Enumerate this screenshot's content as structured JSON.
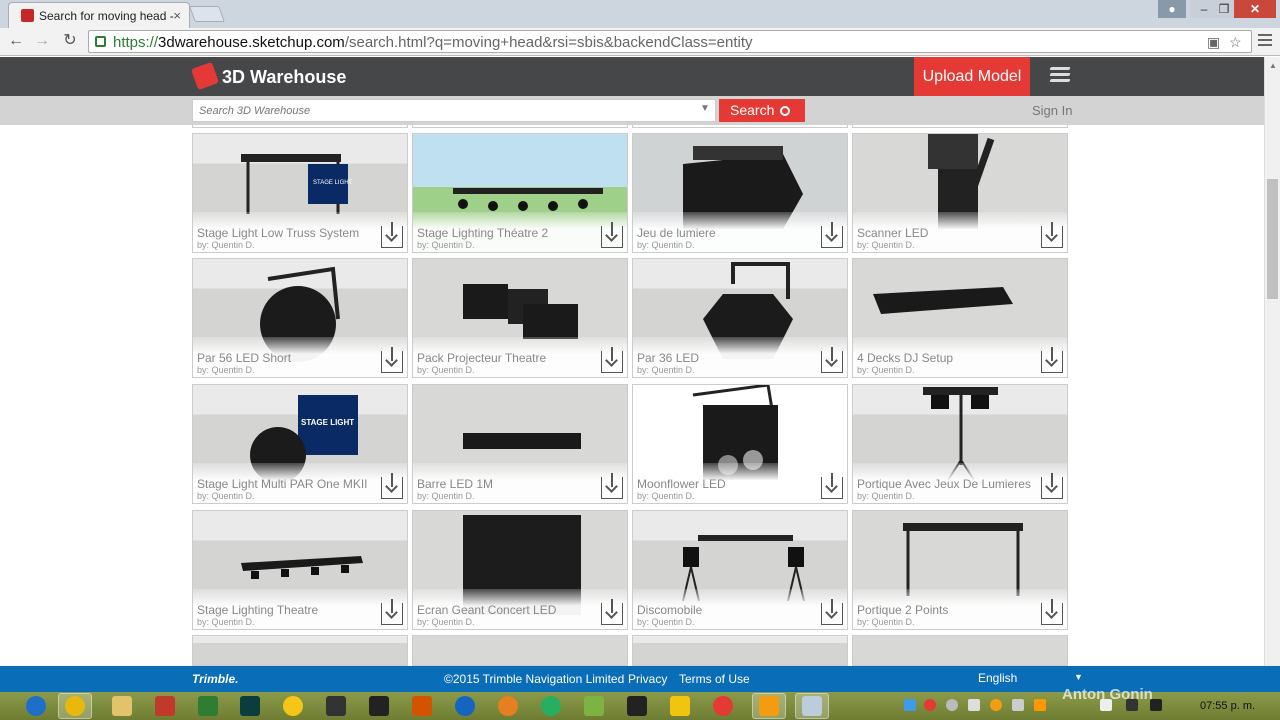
{
  "browser": {
    "tab_title": "Search for moving head -",
    "tab_close": "×",
    "url_scheme": "https://",
    "url_host": "3dwarehouse.sketchup.com",
    "url_path": "/search.html?q=moving+head&rsi=sbis&backendClass=entity",
    "back": "←",
    "forward": "→",
    "reload": "↻",
    "star": "☆",
    "window_min": "–",
    "window_max": "❐",
    "window_close": "✕"
  },
  "header": {
    "logo_text": "3D Warehouse",
    "upload_label": "Upload Model",
    "search_placeholder": "Search 3D Warehouse",
    "search_label": "Search",
    "signin_label": "Sign In"
  },
  "models": [
    {
      "title": "Stage Light Low Truss System",
      "author": "by: Quentin D."
    },
    {
      "title": "Stage Lighting Théatre 2",
      "author": "by: Quentin D."
    },
    {
      "title": "Jeu de lumiere",
      "author": "by: Quentin D."
    },
    {
      "title": "Scanner LED",
      "author": "by: Quentin D."
    },
    {
      "title": "Par 56 LED Short",
      "author": "by: Quentin D."
    },
    {
      "title": "Pack Projecteur Theatre",
      "author": "by: Quentin D."
    },
    {
      "title": "Par 36 LED",
      "author": "by: Quentin D."
    },
    {
      "title": "4 Decks DJ Setup",
      "author": "by: Quentin D."
    },
    {
      "title": "Stage Light Multi PAR One MKII",
      "author": "by: Quentin D."
    },
    {
      "title": "Barre LED 1M",
      "author": "by: Quentin D."
    },
    {
      "title": "Moonflower LED",
      "author": "by: Quentin D."
    },
    {
      "title": "Portique Avec Jeux De Lumieres",
      "author": "by: Quentin D."
    },
    {
      "title": "Stage Lighting Theatre",
      "author": "by: Quentin D."
    },
    {
      "title": "Ecran Geant Concert LED",
      "author": "by: Quentin D."
    },
    {
      "title": "Discomobile",
      "author": "by: Quentin D."
    },
    {
      "title": "Portique 2 Points",
      "author": "by: Quentin D."
    }
  ],
  "thumb_text": {
    "stage_light": "STAGE LIGHT"
  },
  "footer": {
    "brand": "Trimble.",
    "copyright": "©2015 Trimble Navigation Limited",
    "privacy": "Privacy",
    "terms": "Terms of Use",
    "language": "English",
    "language_caret": "▼"
  },
  "taskbar": {
    "clock": "07:55 p. m."
  },
  "watermark": "Anton Gonin",
  "colors": {
    "accent_red": "#e53935",
    "header_dark": "#454749",
    "footer_blue": "#0a6db8"
  }
}
